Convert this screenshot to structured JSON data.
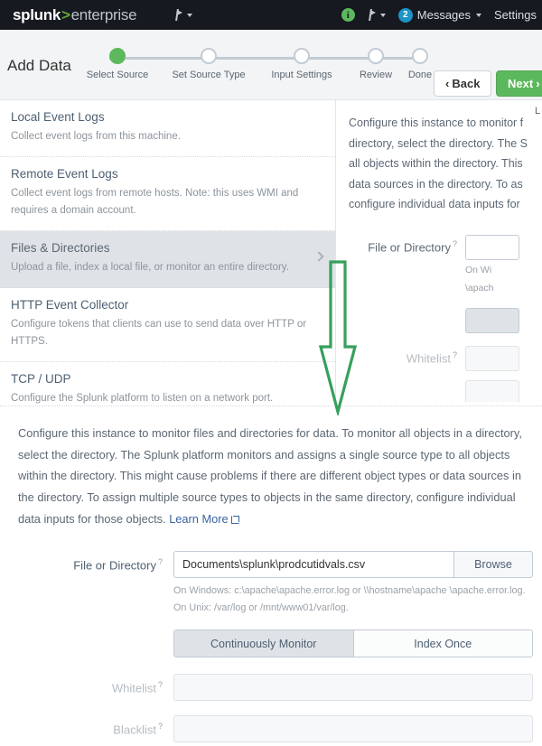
{
  "topbar": {
    "logo": {
      "word1": "splunk",
      "sep": ">",
      "word2": "enterprise"
    },
    "app_menu_icon": "flag-dropdown-icon",
    "info_icon_label": "i",
    "activity_icon": "flag-dropdown-icon",
    "messages_count": "2",
    "messages_label": "Messages",
    "settings_label": "Settings"
  },
  "wizard": {
    "title": "Add Data",
    "steps": [
      {
        "label": "Select Source",
        "state": "done"
      },
      {
        "label": "Set Source Type",
        "state": "pending"
      },
      {
        "label": "Input Settings",
        "state": "pending"
      },
      {
        "label": "Review",
        "state": "pending"
      },
      {
        "label": "Done",
        "state": "pending"
      }
    ],
    "back_label": "Back",
    "next_label": "Next",
    "clipped_label": "L"
  },
  "source_list": [
    {
      "title": "Local Event Logs",
      "desc": "Collect event logs from this machine.",
      "selected": false
    },
    {
      "title": "Remote Event Logs",
      "desc": "Collect event logs from remote hosts. Note: this uses WMI and requires a domain account.",
      "selected": false
    },
    {
      "title": "Files & Directories",
      "desc": "Upload a file, index a local file, or monitor an entire directory.",
      "selected": true
    },
    {
      "title": "HTTP Event Collector",
      "desc": "Configure tokens that clients can use to send data over HTTP or HTTPS.",
      "selected": false
    },
    {
      "title": "TCP / UDP",
      "desc": "Configure the Splunk platform to listen on a network port.",
      "selected": false
    }
  ],
  "right_pane": {
    "paragraph_lines": [
      "Configure this instance to monitor f",
      "directory, select the directory. The S",
      "all objects within the directory. This",
      "data sources in the directory. To as",
      "configure individual data inputs for"
    ],
    "file_label": "File or Directory",
    "hint_lines": [
      "On Wi",
      "\\apach"
    ],
    "whitelist_label": "Whitelist"
  },
  "detail": {
    "paragraph": "Configure this instance to monitor files and directories for data. To monitor all objects in a directory, select the directory. The Splunk platform monitors and assigns a single source type to all objects within the directory. This might cause problems if there are different object types or data sources in the directory. To assign multiple source types to objects in the same directory, configure individual data inputs for those objects.",
    "learn_more": "Learn More",
    "file_label": "File or Directory",
    "file_value": "Documents\\splunk\\prodcutidvals.csv",
    "file_placeholder": "",
    "browse_label": "Browse",
    "file_hint": "On Windows: c:\\apache\\apache.error.log or \\\\hostname\\apache \\apache.error.log. On Unix: /var/log or /mnt/www01/var/log.",
    "monitor_mode_on": "Continuously Monitor",
    "monitor_mode_off": "Index Once",
    "whitelist_label": "Whitelist",
    "whitelist_value": "",
    "blacklist_label": "Blacklist",
    "blacklist_value": ""
  },
  "annotation": {
    "arrow_color": "#36a05c",
    "arrow_direction": "down"
  },
  "colors": {
    "nav_bg": "#16191f",
    "accent_green": "#5cb85c",
    "link_blue": "#3863a0",
    "selected_row": "#dfe3e7"
  }
}
